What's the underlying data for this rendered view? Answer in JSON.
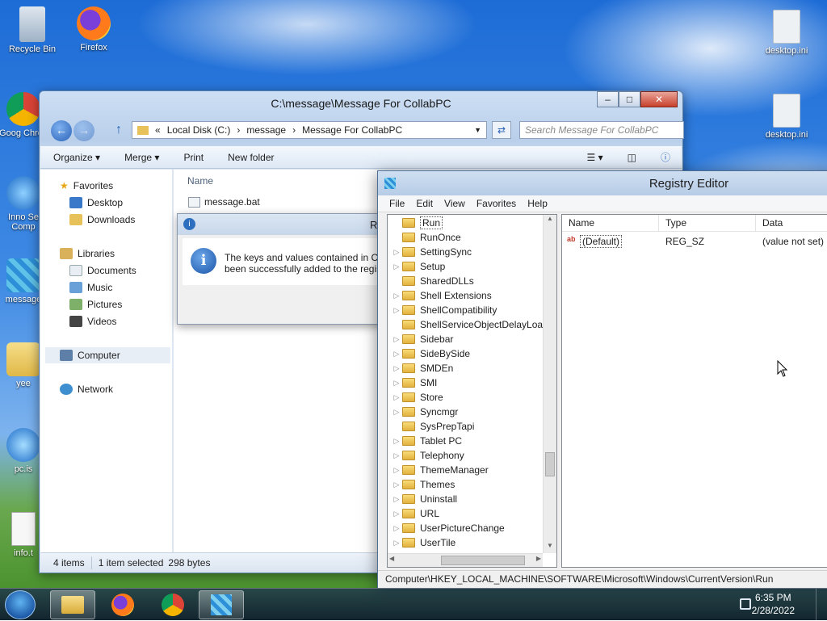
{
  "desktop": {
    "icons_left": [
      {
        "label": "Recycle Bin",
        "icon": "recycle-bin-icon"
      },
      {
        "label": "Firefox",
        "icon": "firefox-icon"
      },
      {
        "label": "Goog Chron",
        "icon": "chrome-icon"
      },
      {
        "label": "Inno Se Comp",
        "icon": "inno-setup-icon"
      },
      {
        "label": "message",
        "icon": "regedit-file-icon"
      },
      {
        "label": "yee",
        "icon": "folder-icon"
      },
      {
        "label": "pc.is",
        "icon": "ie-icon"
      },
      {
        "label": "info.t",
        "icon": "text-file-icon"
      }
    ],
    "icons_right": [
      {
        "label": "desktop.ini",
        "icon": "settings-file-icon"
      },
      {
        "label": "desktop.ini",
        "icon": "settings-file-icon"
      }
    ]
  },
  "explorer": {
    "title": "C:\\message\\Message For CollabPC",
    "breadcrumb": [
      "«",
      "Local Disk (C:)",
      "message",
      "Message For CollabPC"
    ],
    "search_placeholder": "Search Message For CollabPC",
    "toolbar": {
      "organize": "Organize",
      "merge": "Merge",
      "print": "Print",
      "new_folder": "New folder"
    },
    "nav": {
      "favorites": "Favorites",
      "desktop": "Desktop",
      "downloads": "Downloads",
      "libraries": "Libraries",
      "documents": "Documents",
      "music": "Music",
      "pictures": "Pictures",
      "videos": "Videos",
      "computer": "Computer",
      "network": "Network"
    },
    "column_name": "Name",
    "file": "message.bat",
    "status": {
      "items": "4 items",
      "selected": "1 item selected",
      "size": "298 bytes"
    }
  },
  "dialog": {
    "title_fragment": "R",
    "message_line1": "The keys and values contained in C:",
    "message_line2": "been successfully added to the regis"
  },
  "regedit": {
    "title": "Registry Editor",
    "menu": [
      "File",
      "Edit",
      "View",
      "Favorites",
      "Help"
    ],
    "tree": [
      {
        "label": "Run",
        "expandable": false,
        "selected": true
      },
      {
        "label": "RunOnce",
        "expandable": false
      },
      {
        "label": "SettingSync",
        "expandable": true
      },
      {
        "label": "Setup",
        "expandable": true
      },
      {
        "label": "SharedDLLs",
        "expandable": false
      },
      {
        "label": "Shell Extensions",
        "expandable": true
      },
      {
        "label": "ShellCompatibility",
        "expandable": true
      },
      {
        "label": "ShellServiceObjectDelayLoad",
        "expandable": false
      },
      {
        "label": "Sidebar",
        "expandable": true
      },
      {
        "label": "SideBySide",
        "expandable": true
      },
      {
        "label": "SMDEn",
        "expandable": true
      },
      {
        "label": "SMI",
        "expandable": true
      },
      {
        "label": "Store",
        "expandable": true
      },
      {
        "label": "Syncmgr",
        "expandable": true
      },
      {
        "label": "SysPrepTapi",
        "expandable": false
      },
      {
        "label": "Tablet PC",
        "expandable": true
      },
      {
        "label": "Telephony",
        "expandable": true
      },
      {
        "label": "ThemeManager",
        "expandable": true
      },
      {
        "label": "Themes",
        "expandable": true
      },
      {
        "label": "Uninstall",
        "expandable": true
      },
      {
        "label": "URL",
        "expandable": true
      },
      {
        "label": "UserPictureChange",
        "expandable": true
      },
      {
        "label": "UserTile",
        "expandable": true
      }
    ],
    "columns": {
      "name": "Name",
      "type": "Type",
      "data": "Data"
    },
    "values": [
      {
        "name": "(Default)",
        "type": "REG_SZ",
        "data": "(value not set)"
      }
    ],
    "status": "Computer\\HKEY_LOCAL_MACHINE\\SOFTWARE\\Microsoft\\Windows\\CurrentVersion\\Run"
  },
  "taskbar": {
    "time": "6:35 PM",
    "date": "2/28/2022",
    "buttons": [
      "explorer-icon",
      "firefox-icon",
      "chrome-icon",
      "regedit-icon"
    ]
  }
}
